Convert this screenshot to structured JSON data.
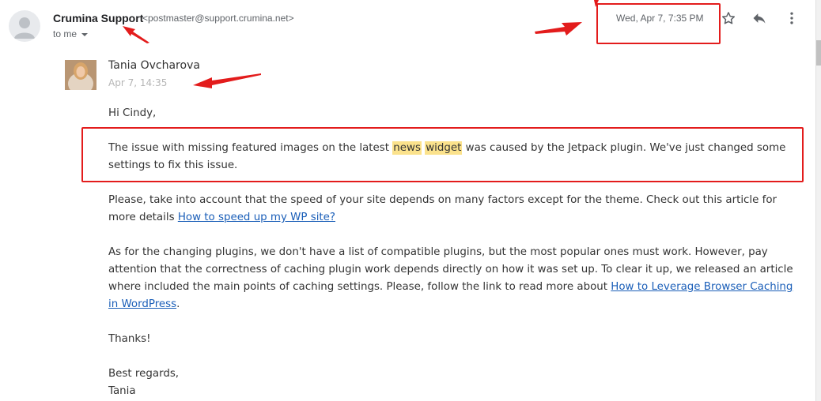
{
  "header": {
    "sender_name": "Crumina Support",
    "sender_email": "<postmaster@support.crumina.net>",
    "recipient_label": "to me",
    "date": "Wed, Apr 7, 7:35 PM",
    "icons": [
      "star-icon",
      "reply-icon",
      "more-vert-icon"
    ]
  },
  "quoted": {
    "author": "Tania Ovcharova",
    "date": "Apr 7, 14:35"
  },
  "body": {
    "greeting": "Hi Cindy,",
    "issue_prefix": "The issue with missing featured images on the latest ",
    "highlight_1": "news",
    "highlight_2": "widget",
    "issue_suffix": " was caused by the Jetpack plugin. We've just changed some settings to fix this issue.",
    "speed_text": "Please, take into account that the speed of your site depends on many factors except for the theme. Check out this article for more details ",
    "speed_link": "How to speed up my WP site?",
    "plugins_text": "As for the changing plugins, we don't have a list of compatible plugins, but the most popular ones must work. However, pay attention that the correctness of caching plugin work depends directly on how it was set up. To clear it up, we released an article where included the main points of caching settings. Please, follow the link to read more about ",
    "plugins_link": "How to Leverage Browser Caching in WordPress",
    "plugins_end": ".",
    "thanks": "Thanks!",
    "regards": "Best regards,",
    "signature": "Tania"
  },
  "colors": {
    "annotation": "#e31c1c",
    "highlight": "#fbe28c",
    "link": "#1a5eb8"
  }
}
